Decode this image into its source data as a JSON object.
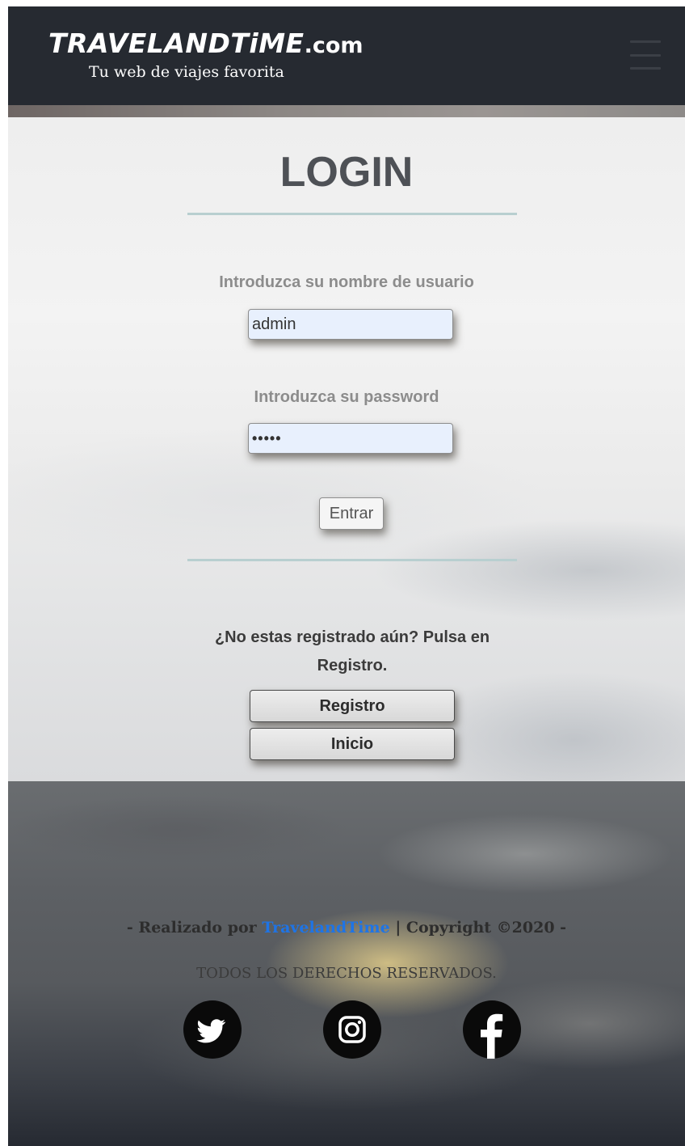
{
  "header": {
    "logo_main": "TRAVELANDTiME",
    "logo_tld": ".com",
    "tagline": "Tu web de viajes favorita",
    "menu_icon": "hamburger-icon"
  },
  "login": {
    "title": "LOGIN",
    "username_label": "Introduzca su nombre de usuario",
    "username_value": "admin",
    "password_label": "Introduzca su password",
    "password_value": "•••••",
    "submit_label": "Entrar"
  },
  "register": {
    "prompt": "¿No estas registrado aún? Pulsa en Registro.",
    "register_label": "Registro",
    "home_label": "Inicio"
  },
  "footer": {
    "credits_prefix": "- Realizado por ",
    "credits_brand": "TravelandTime",
    "credits_suffix": " | Copyright ©2020 -",
    "rights": "TODOS LOS DERECHOS RESERVADOS.",
    "social": [
      "twitter-icon",
      "instagram-icon",
      "facebook-icon"
    ]
  },
  "colors": {
    "header_bg": "#262a31",
    "title": "#4e5156",
    "divider": "#b8cfd0",
    "input_bg": "#e8f0fd",
    "brand_link": "#1e74e6"
  }
}
